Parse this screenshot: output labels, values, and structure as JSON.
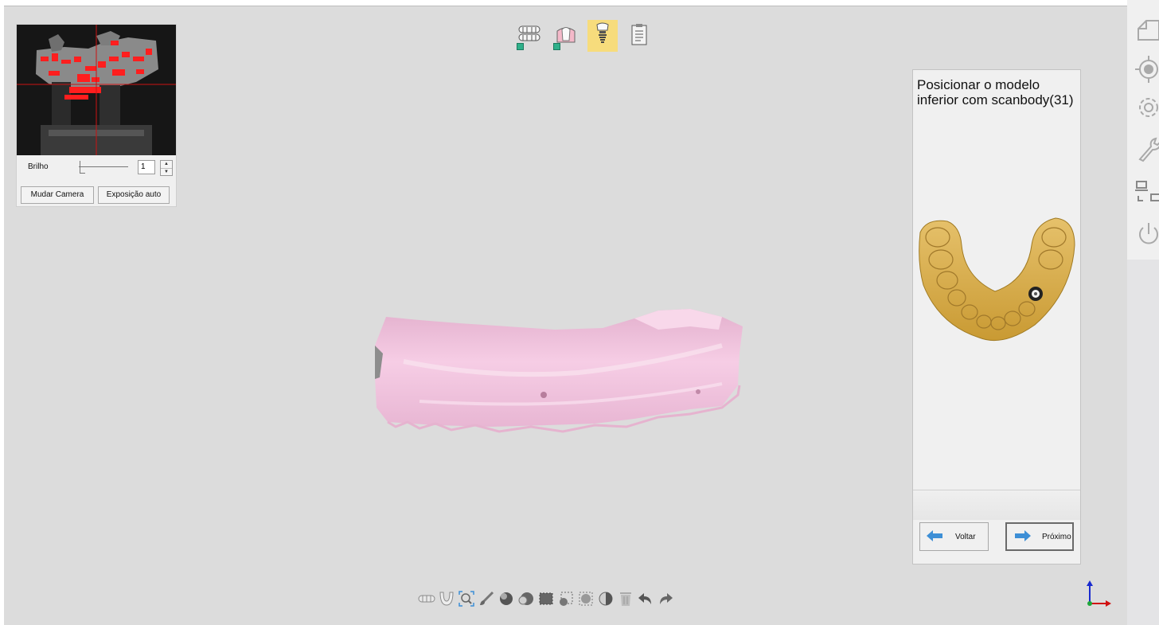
{
  "camera_panel": {
    "brightness_label": "Brilho",
    "brightness_value": "1",
    "brightness_level": 0.0,
    "switch_camera_label": "Mudar Camera",
    "auto_exposure_label": "Exposição auto"
  },
  "mode_toolbar": {
    "items": [
      {
        "icon": "full-arch-icon",
        "completed": true
      },
      {
        "icon": "gum-tooth-icon",
        "completed": true
      },
      {
        "icon": "implant-icon",
        "active": true
      },
      {
        "icon": "report-clipboard-icon"
      }
    ],
    "active_color": "#f7dc7c"
  },
  "instruction_panel": {
    "text": "Posicionar o modelo inferior com scanbody(31)",
    "back_label": "Voltar",
    "next_label": "Próximo"
  },
  "right_sidebar": {
    "icons": [
      "new-file-icon",
      "calibration-target-icon",
      "settings-gear-icon",
      "wrench-icon",
      "network-devices-icon",
      "power-icon"
    ]
  },
  "bottom_toolbar": {
    "icons": [
      "upper-jaw-icon",
      "lower-jaw-icon",
      "zoom-fit-icon",
      "brush-icon",
      "select-sphere-icon",
      "deselect-sphere-icon",
      "lasso-select-icon",
      "lasso-add-icon",
      "lasso-remove-icon",
      "invert-selection-icon",
      "delete-icon",
      "undo-icon",
      "redo-icon"
    ]
  },
  "colors": {
    "viewport_bg": "#dcdcdc",
    "model": "#f2c1de",
    "accent_arrow": "#3d8fd6"
  }
}
